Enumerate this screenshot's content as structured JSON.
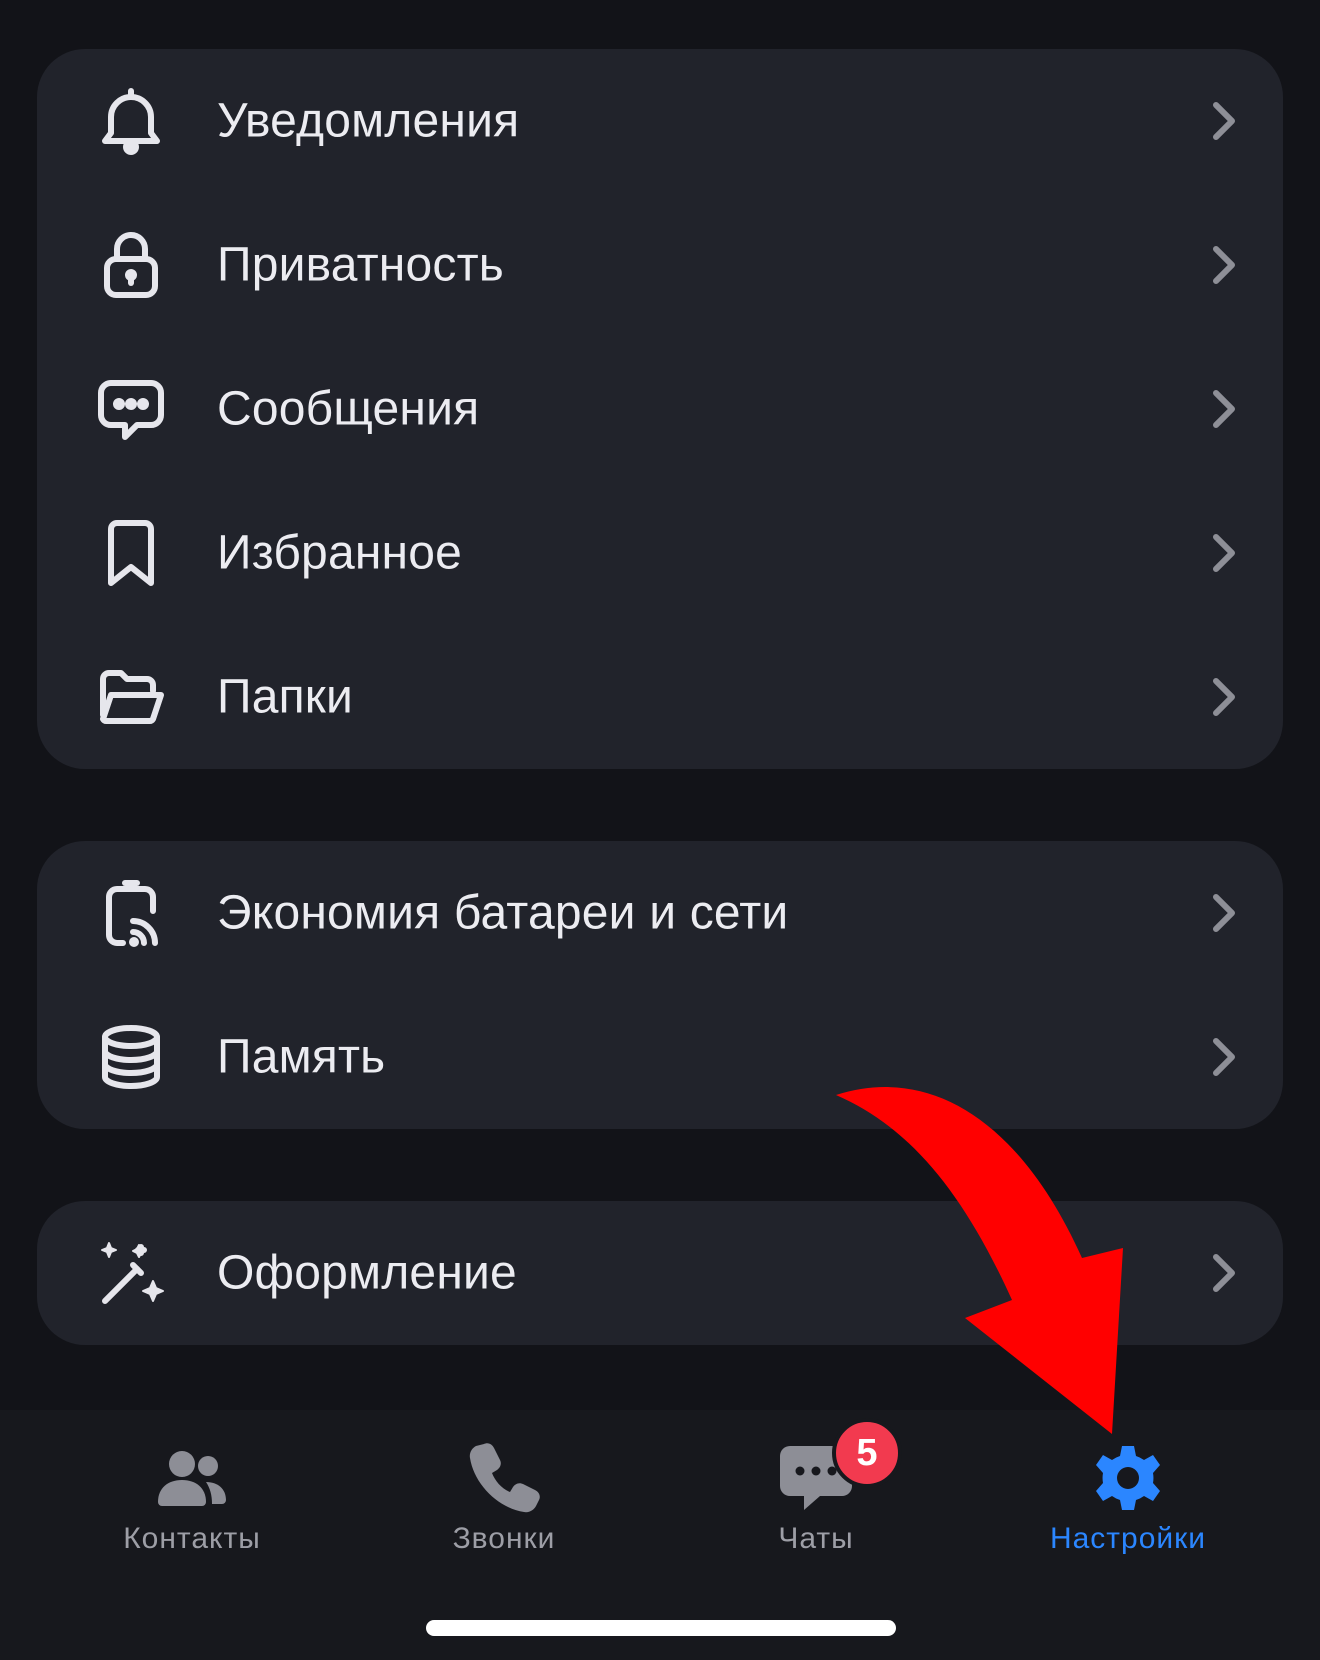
{
  "groups": [
    {
      "items": [
        {
          "label": "Уведомления",
          "icon": "bell-icon"
        },
        {
          "label": "Приватность",
          "icon": "lock-icon"
        },
        {
          "label": "Сообщения",
          "icon": "chat-bubble-icon"
        },
        {
          "label": "Избранное",
          "icon": "bookmark-icon"
        },
        {
          "label": "Папки",
          "icon": "folder-icon"
        }
      ]
    },
    {
      "items": [
        {
          "label": "Экономия батареи и сети",
          "icon": "battery-network-icon"
        },
        {
          "label": "Память",
          "icon": "database-icon"
        }
      ]
    },
    {
      "items": [
        {
          "label": "Оформление",
          "icon": "magic-wand-icon"
        }
      ]
    }
  ],
  "tabbar": {
    "tabs": [
      {
        "label": "Контакты",
        "icon": "contacts-icon",
        "active": false
      },
      {
        "label": "Звонки",
        "icon": "phone-icon",
        "active": false
      },
      {
        "label": "Чаты",
        "icon": "chats-icon",
        "active": false,
        "badge": "5"
      },
      {
        "label": "Настройки",
        "icon": "gear-icon",
        "active": true
      }
    ]
  },
  "colors": {
    "background": "#121318",
    "card": "#21232b",
    "text": "#ececf1",
    "chevron": "#8e8f97",
    "tab_inactive": "#9d9ea6",
    "tab_active": "#2b86ff",
    "badge": "#f23a4f",
    "arrow": "#ff0000"
  }
}
